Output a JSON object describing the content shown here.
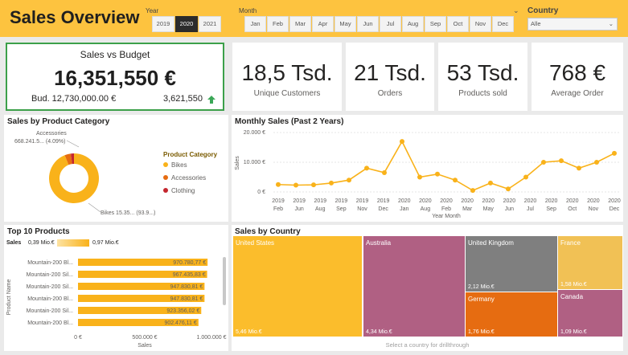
{
  "header": {
    "title": "Sales Overview",
    "year_label": "Year",
    "years": [
      "2019",
      "2020",
      "2021"
    ],
    "selected_year": "2020",
    "month_label": "Month",
    "months": [
      "Jan",
      "Feb",
      "Mar",
      "Apr",
      "May",
      "Jun",
      "Jul",
      "Aug",
      "Sep",
      "Oct",
      "Nov",
      "Dec"
    ],
    "country_label": "Country",
    "country_value": "Alle"
  },
  "budget": {
    "title": "Sales vs Budget",
    "value": "16,351,550 €",
    "budget_text": "Bud. 12,730,000.00 €",
    "delta": "3,621,550"
  },
  "kpis": [
    {
      "value": "18,5 Tsd.",
      "label": "Unique Customers"
    },
    {
      "value": "21 Tsd.",
      "label": "Orders"
    },
    {
      "value": "53 Tsd.",
      "label": "Products sold"
    },
    {
      "value": "768 €",
      "label": "Average Order"
    }
  ],
  "colors": {
    "accent": "#fdc33f",
    "bikes": "#f9b21a",
    "accessories": "#e66c11",
    "clothing": "#c4262e",
    "up_arrow": "#3aa757"
  },
  "chart_data": [
    {
      "type": "pie",
      "title": "Sales by Product Category",
      "legend_title": "Product Category",
      "categories": [
        "Bikes",
        "Accessories",
        "Clothing"
      ],
      "values": [
        93.9,
        4.09,
        2.0
      ],
      "labels": [
        "Bikes 15.35... (93.9...)",
        "Accessories",
        "668.241.5... (4.09%)"
      ]
    },
    {
      "type": "line",
      "title": "Monthly Sales (Past 2 Years)",
      "xlabel": "Year Month",
      "ylabel": "Sales",
      "ylim": [
        0,
        20000
      ],
      "yticks": [
        "0 €",
        "10.000 €",
        "20.000 €"
      ],
      "x_years": [
        "2019",
        "2019",
        "2019",
        "2019",
        "2019",
        "2019",
        "2020",
        "2020",
        "2020",
        "2020",
        "2020",
        "2020",
        "2020",
        "2020",
        "2020",
        "2020",
        "2020",
        "2020",
        "2020",
        "2020",
        "2021",
        "2021",
        "2021",
        "2021",
        "2021"
      ],
      "x_months": [
        "Feb",
        "Jun",
        "Aug",
        "Sep",
        "Nov",
        "Dec",
        "Jan",
        "Feb",
        "Mar",
        "Apr",
        "May",
        "Jun",
        "Jul",
        "Aug",
        "Sep",
        "Oct",
        "Nov",
        "Dec"
      ],
      "x_tick_years": [
        "2019",
        "2019",
        "2019",
        "2019",
        "2019",
        "2019",
        "2020",
        "2020",
        "2020",
        "2020",
        "2020",
        "2020",
        "2020",
        "2020",
        "2020",
        "2020",
        "2020"
      ],
      "x_tick_months": [
        "Feb",
        "Jun",
        "Aug",
        "Sep",
        "Nov",
        "Dec",
        "Jan",
        "Aug",
        "Feb",
        "Mar",
        "May",
        "Jun",
        "Jul",
        "Sep",
        "Oct",
        "Nov",
        "Dec"
      ],
      "values": [
        2500,
        2300,
        2400,
        3000,
        4000,
        8000,
        6500,
        17000,
        5000,
        6000,
        4000,
        500,
        3000,
        1000,
        5000,
        10000,
        10500,
        8000,
        10000,
        13000
      ]
    },
    {
      "type": "bar",
      "title": "Top 10 Products",
      "legend_title": "Sales",
      "legend_min": "0,39 Mio.€",
      "legend_max": "0,97 Mio.€",
      "xlabel": "Sales",
      "ylabel": "Product Name",
      "xticks": [
        "0 €",
        "500.000 €",
        "1.000.000 €"
      ],
      "xlim": [
        0,
        1000000
      ],
      "categories": [
        "Mountain-200 Bl...",
        "Mountain-200 Sil...",
        "Mountain-200 Sil...",
        "Mountain-200 Bl...",
        "Mountain-200 Sil...",
        "Mountain-200 Bl..."
      ],
      "values": [
        970780.77,
        967435.83,
        947830.81,
        947830.81,
        923356.02,
        902476.11
      ],
      "value_labels": [
        "970.780,77 €",
        "967.435,83 €",
        "947.830,81 €",
        "947.830,81 €",
        "923.356,02 €",
        "902.476,11 €"
      ]
    },
    {
      "type": "heatmap",
      "title": "Sales by Country",
      "footer": "Select a country for drillthrough",
      "countries": [
        {
          "name": "United States",
          "value": "5,46 Mio.€",
          "color": "#fbbd2c"
        },
        {
          "name": "Australia",
          "value": "4,34 Mio.€",
          "color": "#b06083"
        },
        {
          "name": "United Kingdom",
          "value": "2,12 Mio.€",
          "color": "#7f7f7f"
        },
        {
          "name": "Germany",
          "value": "1,76 Mio.€",
          "color": "#e66c11"
        },
        {
          "name": "France",
          "value": "1,58 Mio.€",
          "color": "#f1c155"
        },
        {
          "name": "Canada",
          "value": "1,09 Mio.€",
          "color": "#b06083"
        }
      ]
    }
  ]
}
